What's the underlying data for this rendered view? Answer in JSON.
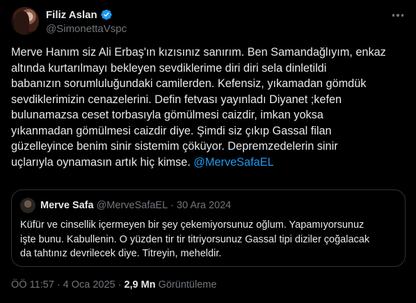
{
  "author": {
    "display_name": "Filiz Aslan",
    "handle": "@SimonettaVspc",
    "verified": true
  },
  "tweet": {
    "text": "Merve Hanım siz Ali Erbaş'ın kızısınız sanırım. Ben Samandağlıyım, enkaz\naltında kurtarılmayı bekleyen sevdiklerime diri diri sela dinletildi\nbabanızın sorumluluğundaki camilerden. Kefensiz, yıkamadan gömdük\nsevdiklerimizin cenazelerini. Defin fetvası yayınladı Diyanet ;kefen\nbulunamazsa ceset torbasıyla gömülmesi caizdir, imkan yoksa\nyıkanmadan gömülmesi caizdir diye. Şimdi siz çıkıp Gassal filan\ngüzelleyince benim sinir sistemim çöküyor. Depremzedelerin sinir\nuçlarıyla oynamasın artık hiç kimse.  ",
    "mention": "@MerveSafaEL"
  },
  "quote": {
    "display_name": "Merve Safa",
    "handle": "@MerveSafaEL",
    "separator": "·",
    "date": "30 Ara 2024",
    "text": "Küfür ve cinsellik içermeyen bir şey çekemiyorsunuz oğlum. Yapamıyorsunuz\nişte bunu. Kabullenin. O yüzden tir tir titriyorsunuz Gassal tipi diziler çoğalacak\nda tahtınız devrilecek diye. Titreyin, meheldir."
  },
  "footer": {
    "time": "ÖÖ 11:57",
    "sep1": "·",
    "date": "4 Oca 2025",
    "sep2": "·",
    "views_count": "2,9 Mn",
    "views_label": "Görüntüleme"
  },
  "colors": {
    "accent": "#1d9bf0",
    "background": "#000000",
    "text": "#e7e9ea",
    "muted": "#71767b",
    "border": "#2f3336"
  },
  "icons": {
    "verified": "verified-badge-icon",
    "more": "more-options-icon"
  }
}
